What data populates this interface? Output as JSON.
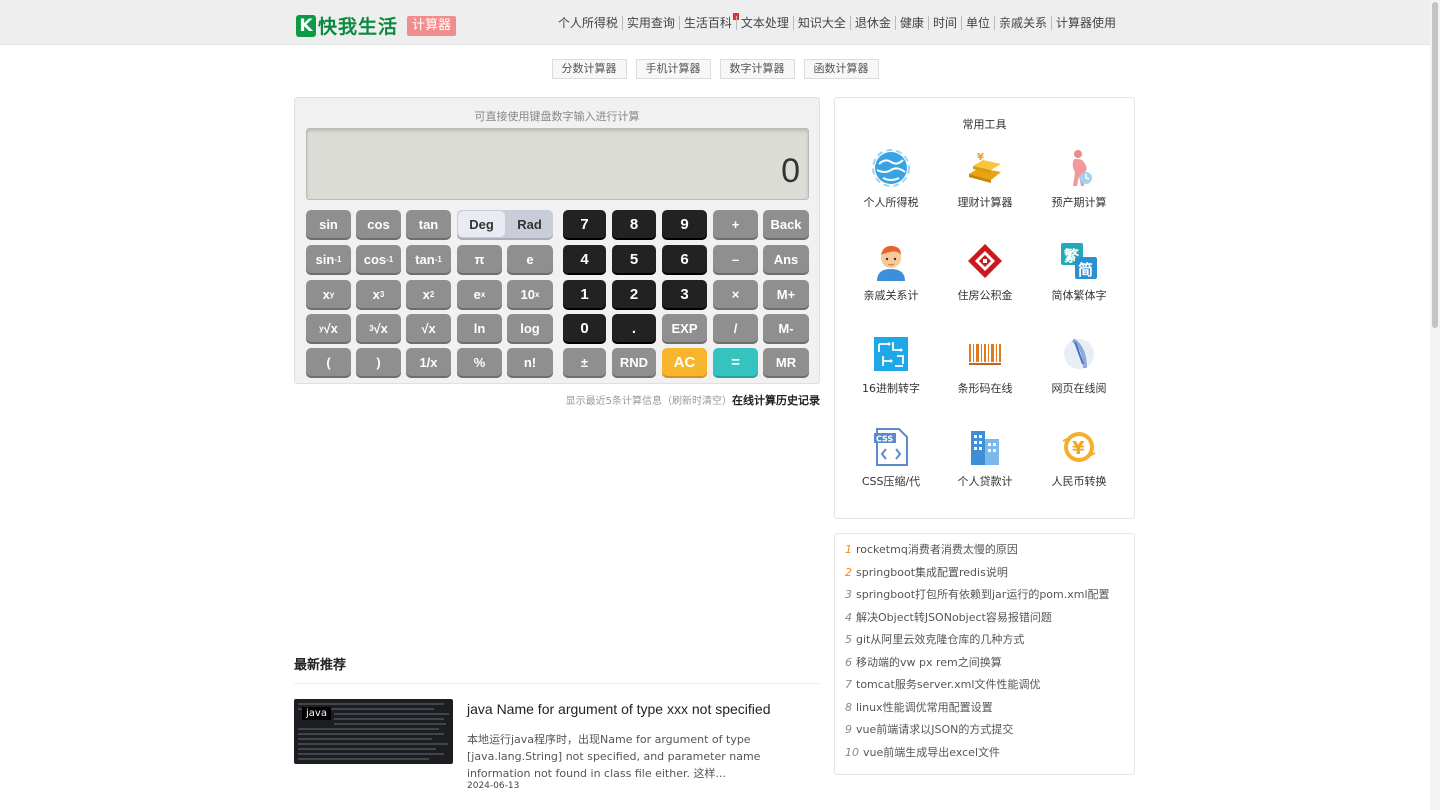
{
  "brand": {
    "name": "快我生活",
    "badge": "计算器",
    "mark": "K"
  },
  "nav": [
    "个人所得税",
    "实用查询",
    "生活百科",
    "文本处理",
    "知识大全",
    "退休金",
    "健康",
    "时间",
    "单位",
    "亲戚关系",
    "计算器使用"
  ],
  "subtabs": [
    "分数计算器",
    "手机计算器",
    "数字计算器",
    "函数计算器"
  ],
  "calculator": {
    "hint": "可直接使用键盘数字输入进行计算",
    "display_value": "0",
    "mode": {
      "deg": "Deg",
      "rad": "Rad"
    },
    "keys": {
      "sin": "sin",
      "cos": "cos",
      "tan": "tan",
      "asin": "sin",
      "acos": "cos",
      "atan": "tan",
      "inv": "-1",
      "pi": "π",
      "e": "e",
      "x": "x",
      "y": "y",
      "three": "3",
      "two": "2",
      "ten": "10",
      "yroot_y": "y",
      "root": "√x",
      "cbrt_3": "3",
      "sqrt": "√x",
      "ln": "ln",
      "log": "log",
      "lparen": "(",
      "rparen": ")",
      "recip": "1/x",
      "percent": "%",
      "fact": "n!",
      "d7": "7",
      "d8": "8",
      "d9": "9",
      "d4": "4",
      "d5": "5",
      "d6": "6",
      "d1": "1",
      "d2": "2",
      "d3": "3",
      "d0": "0",
      "dot": ".",
      "plus": "+",
      "minus": "–",
      "times": "×",
      "divide": "/",
      "exp": "EXP",
      "neg": "±",
      "rnd": "RND",
      "ac": "AC",
      "equals": "=",
      "back": "Back",
      "ans": "Ans",
      "mplus": "M+",
      "mminus": "M-",
      "mr": "MR"
    },
    "history_note": "显示最近5条计算信息（刷新时清空）",
    "history_link": "在线计算历史记录"
  },
  "tools": {
    "title": "常用工具",
    "items": [
      {
        "label": "个人所得税",
        "icon": "globe-icon"
      },
      {
        "label": "理财计算器",
        "icon": "gold-bar-icon"
      },
      {
        "label": "预产期计算",
        "icon": "pregnancy-icon"
      },
      {
        "label": "亲戚关系计",
        "icon": "person-icon"
      },
      {
        "label": "住房公积金",
        "icon": "housing-fund-icon"
      },
      {
        "label": "简体繁体字",
        "icon": "chinese-convert-icon"
      },
      {
        "label": "16进制转字",
        "icon": "hex-grid-icon"
      },
      {
        "label": "条形码在线",
        "icon": "barcode-icon"
      },
      {
        "label": "网页在线阅",
        "icon": "web-reader-icon"
      },
      {
        "label": "CSS压缩/代",
        "icon": "css-file-icon"
      },
      {
        "label": "个人贷款计",
        "icon": "building-icon"
      },
      {
        "label": "人民币转换",
        "icon": "yuan-exchange-icon"
      }
    ]
  },
  "articles": [
    {
      "n": "1",
      "title": "rocketmq消费者消费太慢的原因"
    },
    {
      "n": "2",
      "title": "springboot集成配置redis说明"
    },
    {
      "n": "3",
      "title": "springboot打包所有依赖到jar运行的pom.xml配置"
    },
    {
      "n": "4",
      "title": "解决Object转JSONobject容易报错问题"
    },
    {
      "n": "5",
      "title": "git从阿里云效克隆仓库的几种方式"
    },
    {
      "n": "6",
      "title": "移动端的vw px rem之间换算"
    },
    {
      "n": "7",
      "title": "tomcat服务server.xml文件性能调优"
    },
    {
      "n": "8",
      "title": "linux性能调优常用配置设置"
    },
    {
      "n": "9",
      "title": "vue前端请求以JSON的方式提交"
    },
    {
      "n": "10",
      "title": "vue前端生成导出excel文件"
    }
  ],
  "recommend": {
    "heading": "最新推荐",
    "tag": "java",
    "title": "java Name for argument of type xxx not specified",
    "desc": "本地运行java程序时，出现Name for argument of type [java.lang.String] not specified, and parameter name information not found in class file either. 这样...",
    "date": "2024-06-13"
  }
}
